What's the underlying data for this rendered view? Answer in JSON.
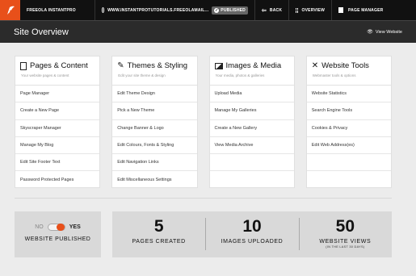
{
  "topbar": {
    "brand": "FREEOLA INSTANTPRO",
    "site": "WWW.INSTANTPROTUTORIALS.FREEOLAMAIL...",
    "status": "PUBLISHED",
    "back": "BACK",
    "overview": "OVERVIEW",
    "page_manager": "PAGE MANAGER",
    "brand_color": "#e8501a"
  },
  "header": {
    "title": "Site Overview",
    "view_website": "View Website"
  },
  "cards": [
    {
      "icon": "document-icon",
      "title": "Pages & Content",
      "subtitle": "Your website pages & content",
      "items": [
        "Page Manager",
        "Create a New Page",
        "Skyscraper Manager",
        "Manage My Blog",
        "Edit Site Footer Text",
        "Password Protected Pages"
      ]
    },
    {
      "icon": "paintbrush-icon",
      "title": "Themes & Styling",
      "subtitle": "Edit your site theme & design",
      "items": [
        "Edit Theme Design",
        "Pick a New Theme",
        "Change Banner & Logo",
        "Edit Colours, Fonts & Styling",
        "Edit Navigation Links",
        "Edit Miscellaneous Settings"
      ]
    },
    {
      "icon": "image-icon",
      "title": "Images & Media",
      "subtitle": "Your media, photos & galleries",
      "items": [
        "Upload Media",
        "Manage My Galleries",
        "Create a New Gallery",
        "View Media Archive"
      ]
    },
    {
      "icon": "tools-icon",
      "title": "Website Tools",
      "subtitle": "Webmaster tools & options",
      "items": [
        "Website Statistics",
        "Search Engine Tools",
        "Cookies & Privacy",
        "Edit Web Address(es)"
      ]
    }
  ],
  "publish": {
    "no": "NO",
    "yes": "YES",
    "label": "WEBSITE PUBLISHED",
    "on": true
  },
  "stats": [
    {
      "value": "5",
      "label": "PAGES CREATED",
      "note": ""
    },
    {
      "value": "10",
      "label": "IMAGES UPLOADED",
      "note": ""
    },
    {
      "value": "50",
      "label": "WEBSITE VIEWS",
      "note": "(IN THE LAST 30 DAYS)"
    }
  ]
}
